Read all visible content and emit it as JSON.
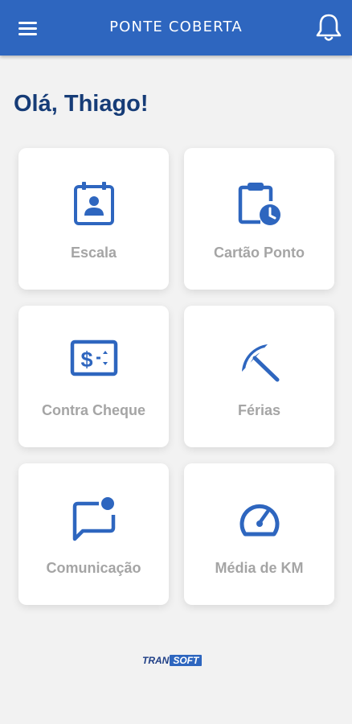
{
  "header": {
    "title": "PONTE COBERTA",
    "menu_icon": "menu-icon",
    "notification_icon": "bell-icon"
  },
  "greeting": "Olá, Thiago!",
  "cards": [
    {
      "label": "Escala",
      "icon": "badge-calendar-icon"
    },
    {
      "label": "Cartão Ponto",
      "icon": "clipboard-clock-icon"
    },
    {
      "label": "Contra Cheque",
      "icon": "paycheck-icon"
    },
    {
      "label": "Férias",
      "icon": "beach-umbrella-icon"
    },
    {
      "label": "Comunicação",
      "icon": "chat-notification-icon"
    },
    {
      "label": "Média de KM",
      "icon": "speedometer-icon"
    }
  ],
  "footer": {
    "brand_part1": "TRAN",
    "brand_part2": "SOFT"
  },
  "colors": {
    "header_bg": "#2e66bf",
    "icon_blue": "#2e66bf",
    "greeting": "#163c77",
    "card_label": "#a5a5a5",
    "background": "#f2f2f2"
  }
}
